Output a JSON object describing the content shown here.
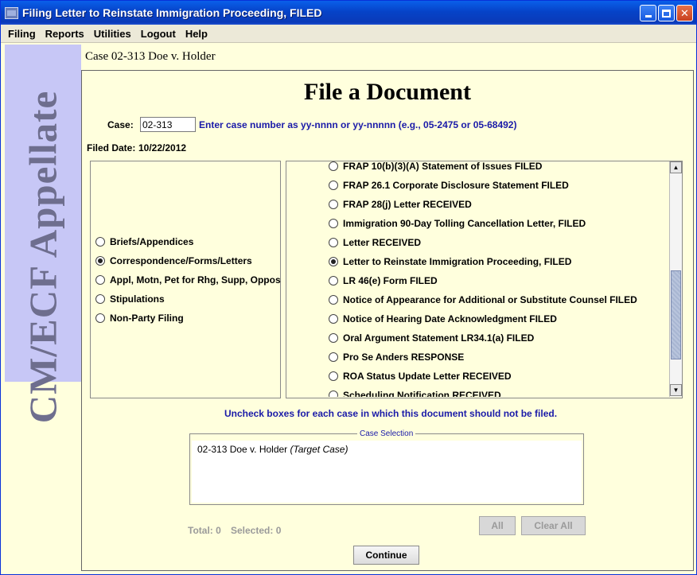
{
  "window": {
    "title": "Filing Letter to Reinstate Immigration Proceeding, FILED"
  },
  "menu": [
    "Filing",
    "Reports",
    "Utilities",
    "Logout",
    "Help"
  ],
  "side_banner": "CM/ECF Appellate",
  "case_header": "Case 02-313 Doe v. Holder",
  "page_title": "File a Document",
  "case_field": {
    "label": "Case:",
    "value": "02-313",
    "hint": "Enter case number as yy-nnnn or yy-nnnnn (e.g., 05-2475 or 05-68492)"
  },
  "filed_date": {
    "label": "Filed Date:",
    "value": "10/22/2012"
  },
  "categories": [
    {
      "label": "Briefs/Appendices",
      "checked": false
    },
    {
      "label": "Correspondence/Forms/Letters",
      "checked": true
    },
    {
      "label": "Appl, Motn, Pet for Rhg, Supp, Oppos",
      "checked": false
    },
    {
      "label": "Stipulations",
      "checked": false
    },
    {
      "label": "Non-Party Filing",
      "checked": false
    }
  ],
  "documents": [
    {
      "label": "FRAP 10(b)(3)(A) Statement of Issues FILED",
      "checked": false
    },
    {
      "label": "FRAP 26.1 Corporate Disclosure Statement FILED",
      "checked": false
    },
    {
      "label": "FRAP 28(j) Letter RECEIVED",
      "checked": false
    },
    {
      "label": "Immigration 90-Day Tolling Cancellation Letter, FILED",
      "checked": false
    },
    {
      "label": "Letter RECEIVED",
      "checked": false
    },
    {
      "label": "Letter to Reinstate Immigration Proceeding, FILED",
      "checked": true
    },
    {
      "label": "LR 46(e) Form FILED",
      "checked": false
    },
    {
      "label": "Notice of Appearance for Additional or Substitute Counsel FILED",
      "checked": false
    },
    {
      "label": "Notice of Hearing Date Acknowledgment FILED",
      "checked": false
    },
    {
      "label": "Oral Argument Statement LR34.1(a) FILED",
      "checked": false
    },
    {
      "label": "Pro Se Anders RESPONSE",
      "checked": false
    },
    {
      "label": "ROA Status Update Letter RECEIVED",
      "checked": false
    },
    {
      "label": "Scheduling Notification RECEIVED",
      "checked": false
    }
  ],
  "uncheck_instruction": "Uncheck boxes for each case in which this document should not be filed.",
  "case_selection": {
    "legend": "Case Selection",
    "entry": "02-313 Doe v. Holder",
    "entry_tag": "(Target Case)"
  },
  "counts": {
    "total": "Total: 0",
    "selected": "Selected: 0"
  },
  "buttons": {
    "all": "All",
    "clear_all": "Clear All",
    "continue": "Continue"
  }
}
